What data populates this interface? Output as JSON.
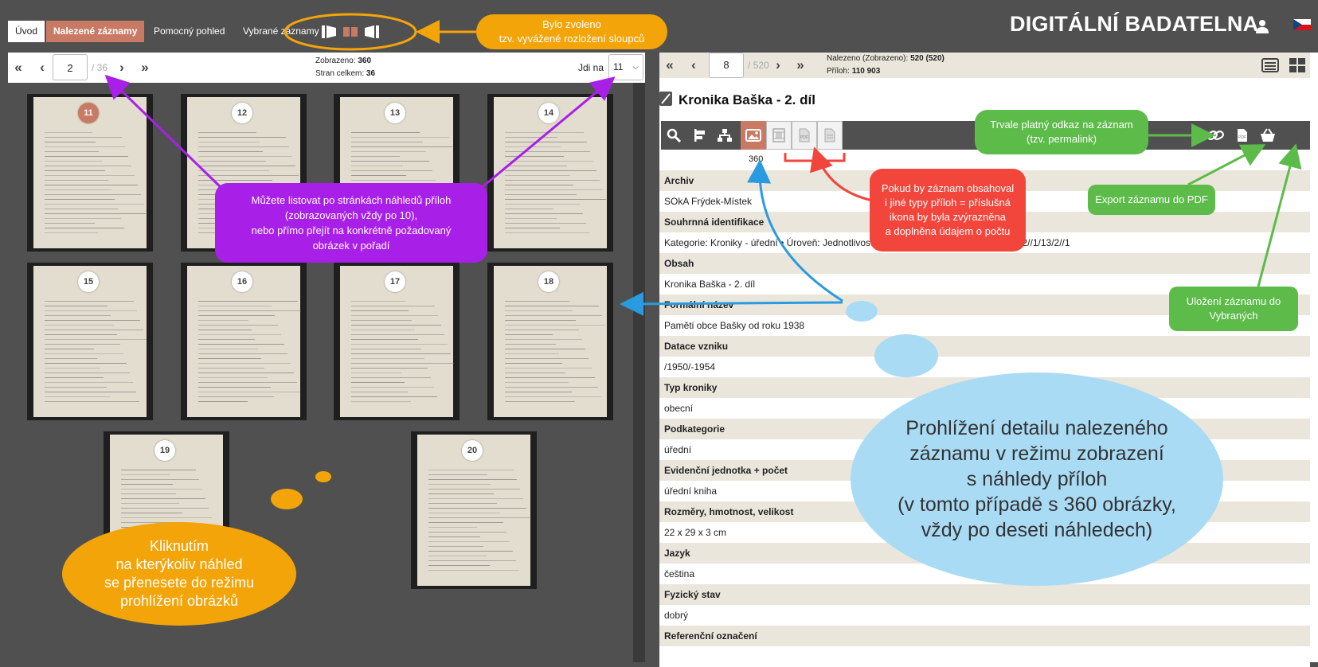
{
  "header": {
    "tabs": [
      {
        "label": "Úvod"
      },
      {
        "label": "Nalezené záznamy"
      },
      {
        "label": "Pomocný pohled"
      },
      {
        "label": "Vybrané záznamy"
      }
    ],
    "site_title": "DIGITÁLNÍ BADATELNA"
  },
  "left_toolbar": {
    "current_page": "2",
    "total_pages": "/ 36",
    "shown_label": "Zobrazeno:",
    "shown_value": "360",
    "pages_label": "Stran celkem:",
    "pages_value": "36",
    "goto_label": "Jdi na",
    "goto_value": "11"
  },
  "thumbnails": [
    {
      "number": "11",
      "active": true
    },
    {
      "number": "12"
    },
    {
      "number": "13"
    },
    {
      "number": "14"
    },
    {
      "number": "15"
    },
    {
      "number": "16"
    },
    {
      "number": "17"
    },
    {
      "number": "18"
    },
    {
      "number": "19"
    },
    {
      "number": "20"
    }
  ],
  "right_toolbar": {
    "current_record": "8",
    "total_records": "/ 520",
    "found_label": "Nalezeno (Zobrazeno):",
    "found_value": "520 (520)",
    "attach_label": "Příloh:",
    "attach_value": "110 903"
  },
  "record": {
    "title": "Kronika Baška - 2. díl",
    "image_count": "360",
    "fields": [
      {
        "label": "Archiv",
        "value": "SOkA Frýdek-Místek"
      },
      {
        "label": "Souhrnná identifikace",
        "value": "Kategorie: Kroniky - úřední • Úroveň: Jednotlivost • ... • č. pom. 1090 CZ227202010//2//1/13/2//1"
      },
      {
        "label": "Obsah",
        "value": "Kronika Baška - 2. díl"
      },
      {
        "label": "Formální název",
        "value": "Paměti obce Bašky od roku 1938"
      },
      {
        "label": "Datace vzniku",
        "value": "/1950/-1954"
      },
      {
        "label": "Typ kroniky",
        "value": "obecní"
      },
      {
        "label": "Podkategorie",
        "value": "úřední"
      },
      {
        "label": "Evidenční jednotka + počet",
        "value": "úřední kniha"
      },
      {
        "label": "Rozměry, hmotnost, velikost",
        "value": "22 x 29 x 3 cm"
      },
      {
        "label": "Jazyk",
        "value": "čeština"
      },
      {
        "label": "Fyzický stav",
        "value": "dobrý"
      },
      {
        "label": "Referenční označení",
        "value": ""
      }
    ]
  },
  "annotations": {
    "layout_note": "Bylo zvoleno\ntzv. vyvážené rozložení sloupců",
    "paging_note": "Můžete listovat po stránkách náhledů příloh\n(zobrazovaných vždy po 10),\nnebo přímo přejít na konkrétně požadovaný\nobrázek v pořadí",
    "click_note": "Kliknutím\nna kterýkoliv náhled\nse přenesete do režimu\nprohlížení obrázků",
    "permalink_note": "Trvale platný odkaz na záznam\n(tzv. permalink)",
    "pdf_note": "Export záznamu do PDF",
    "save_note": "Uložení záznamu do\nVybraných",
    "types_note": "Pokud by záznam obsahoval\ni jiné typy příloh = příslušná\nikona by byla zvýrazněna\na doplněna údajem o počtu",
    "detail_note": "Prohlížení detailu nalezeného\nzáznamu v režimu zobrazení\ns náhledy příloh\n(v tomto případě s 360 obrázky,\nvždy po deseti náhledech)"
  },
  "colors": {
    "accent": "#c97a65",
    "background": "#505050",
    "row_label_bg": "#eae6dc",
    "annotation_orange": "#f3a408",
    "annotation_purple": "#a820e8",
    "annotation_green": "#5dbb4a",
    "annotation_red": "#f2453b",
    "annotation_blue": "#a9dbf5"
  },
  "icons": [
    "layout-left-icon",
    "layout-balanced-icon",
    "layout-right-icon",
    "user-icon",
    "flag-cz-icon",
    "search-icon",
    "signpost-icon",
    "hierarchy-icon",
    "image-icon",
    "video-icon",
    "pdf-icon",
    "document-icon",
    "link-icon",
    "basket-icon",
    "list-view-icon",
    "grid-view-icon"
  ]
}
